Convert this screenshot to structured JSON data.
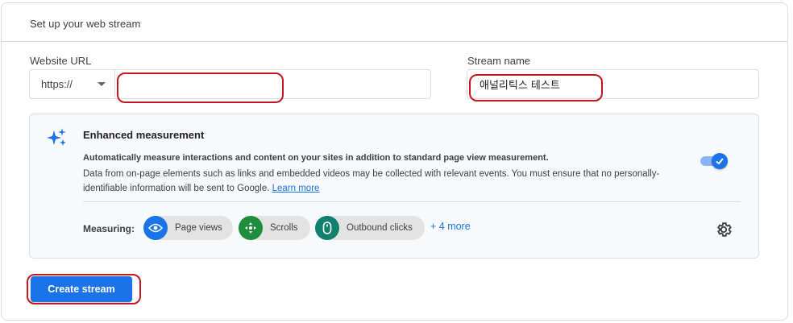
{
  "card": {
    "title": "Set up your web stream"
  },
  "website_url": {
    "label": "Website URL",
    "protocol": "https://",
    "value": ""
  },
  "stream_name": {
    "label": "Stream name",
    "value": "애널리틱스 테스트"
  },
  "enhanced": {
    "icon": "sparkle-icon",
    "title": "Enhanced measurement",
    "bold_text": "Automatically measure interactions and content on your sites in addition to standard page view measurement.",
    "description": "Data from on-page elements such as links and embedded videos may be collected with relevant events. You must ensure that no personally-identifiable information will be sent to Google.",
    "learn_more": "Learn more",
    "toggle_on": true,
    "measuring_label": "Measuring:",
    "chips": [
      {
        "label": "Page views",
        "icon": "eye-icon",
        "color": "#1a73e8"
      },
      {
        "label": "Scrolls",
        "icon": "crosshair-icon",
        "color": "#1e8e3e"
      },
      {
        "label": "Outbound clicks",
        "icon": "mouse-icon",
        "color": "#12806e"
      }
    ],
    "more": "+ 4 more",
    "settings_icon": "gear-icon"
  },
  "create_button": "Create stream",
  "colors": {
    "accent": "#1a73e8",
    "annotation": "#c5161d"
  }
}
